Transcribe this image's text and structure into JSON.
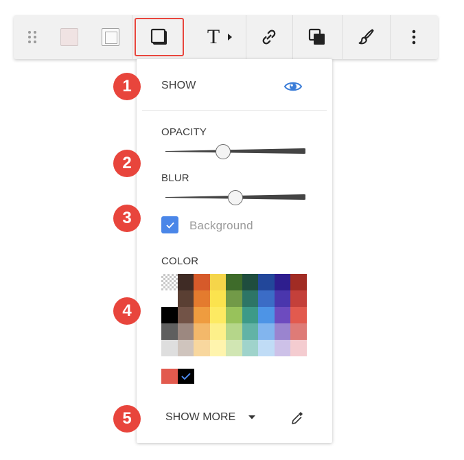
{
  "toolbar": {
    "items": [
      {
        "name": "drag-handle-icon"
      },
      {
        "name": "fill-color-icon"
      },
      {
        "name": "stroke-color-icon"
      },
      {
        "name": "shadow-icon",
        "active": true
      },
      {
        "name": "text-icon",
        "label": "T"
      },
      {
        "name": "link-icon"
      },
      {
        "name": "arrange-icon"
      },
      {
        "name": "style-brush-icon"
      },
      {
        "name": "more-vert-icon"
      }
    ]
  },
  "panel": {
    "show_label": "SHOW",
    "opacity_label": "OPACITY",
    "opacity_value": 0.4,
    "blur_label": "BLUR",
    "blur_value": 0.5,
    "background_label": "Background",
    "background_checked": true,
    "color_label": "COLOR",
    "palette": [
      [
        "transparent",
        "#3f2b25",
        "#d65a2a",
        "#f5d54a",
        "#3e6b2a",
        "#1f4d3e",
        "#22479a",
        "#2e1e8e",
        "#a12c24"
      ],
      [
        "#ffffff",
        "#5a3f33",
        "#e47b2e",
        "#fbe34e",
        "#729a48",
        "#2d7566",
        "#3b6cc6",
        "#4a36ad",
        "#c4403a"
      ],
      [
        "#000000",
        "#725347",
        "#ef9c3f",
        "#fdea62",
        "#98c25b",
        "#3d9a88",
        "#4d94e6",
        "#6d4bbf",
        "#e25a4e"
      ],
      [
        "#5f5f5f",
        "#9c8880",
        "#f3b86a",
        "#fdf08a",
        "#b5d68a",
        "#62b3a6",
        "#82b5ee",
        "#9a84cf",
        "#de7b77"
      ],
      [
        "#dedede",
        "#cfc4bd",
        "#f8d79e",
        "#fff4ad",
        "#d1e6b3",
        "#9fd3cb",
        "#c0dcf6",
        "#cdc1e8",
        "#f4ccd0"
      ]
    ],
    "recent_colors": [
      "#e25a4e",
      "#000000"
    ],
    "selected_recent": 1,
    "show_more_label": "SHOW MORE"
  },
  "badges": [
    "1",
    "2",
    "3",
    "4",
    "5"
  ],
  "colors": {
    "accent": "#e8453c",
    "checkbox": "#4a86e8",
    "eye": "#3b7dd8"
  }
}
